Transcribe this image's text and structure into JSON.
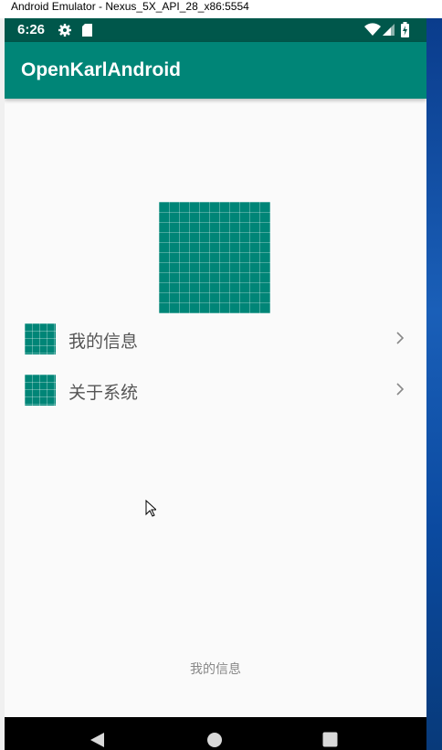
{
  "window": {
    "title": "Android Emulator - Nexus_5X_API_28_x86:5554"
  },
  "status_bar": {
    "time": "6:26"
  },
  "app_bar": {
    "title": "OpenKarlAndroid"
  },
  "menu": {
    "items": [
      {
        "label": "我的信息"
      },
      {
        "label": "关于系统"
      }
    ]
  },
  "bottom_nav": {
    "label": "我的信息"
  },
  "colors": {
    "primary": "#008577",
    "primary_dark": "#00574b",
    "background": "#fafafa"
  }
}
